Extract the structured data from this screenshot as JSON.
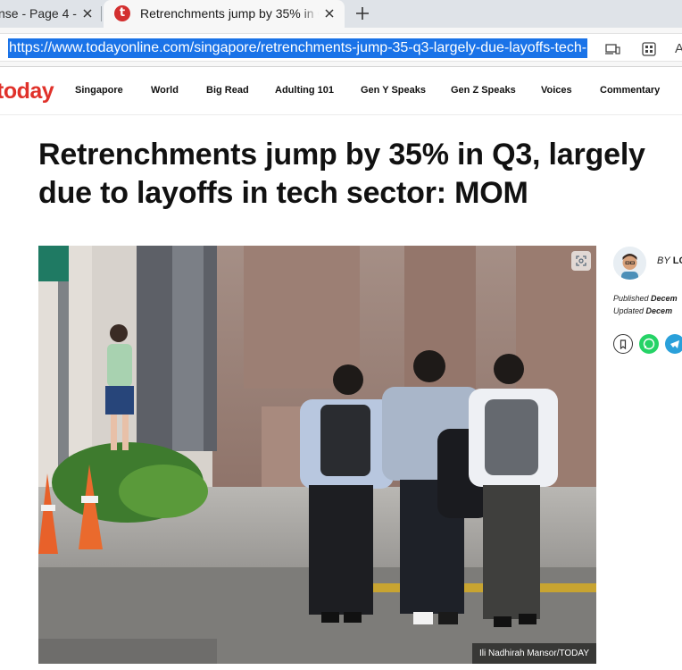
{
  "browser": {
    "tabs": [
      {
        "title": "nse - Page 4 -",
        "active": false
      },
      {
        "title": "Retrenchments jump by 35% in Q",
        "active": true
      }
    ],
    "url": "https://www.todayonline.com/singapore/retrenchments-jump-35-q3-largely-due-layoffs-tech-",
    "icons": [
      "close-icon",
      "plus-icon",
      "devices-icon",
      "apps-icon"
    ],
    "edge_text": "A",
    "selection_color": "#1a73e8"
  },
  "site": {
    "logo": "today",
    "brand_color": "#e0312a",
    "nav": [
      "Singapore",
      "World",
      "Big Read",
      "Adulting 101",
      "Gen Y Speaks",
      "Gen Z Speaks",
      "Voices",
      "Commentary"
    ]
  },
  "article": {
    "headline": "Retrenchments jump by 35% in Q3, largely due to layoffs in tech sector: MOM",
    "photo_credit": "Ili Nadhirah Mansor/TODAY",
    "byline_prefix": "BY",
    "byline_name": "LO",
    "published_label": "Published",
    "published_date": "Decem",
    "updated_label": "Updated",
    "updated_date": "Decem"
  }
}
